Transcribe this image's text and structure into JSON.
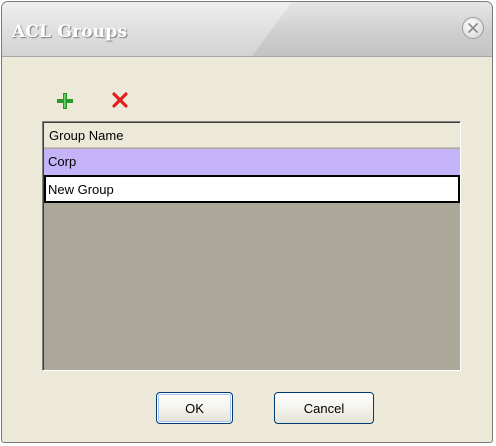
{
  "window": {
    "title": "ACL Groups",
    "close_icon": "close-icon"
  },
  "toolbar": {
    "add_icon": "plus-icon",
    "add_color": "#2a9a2a",
    "delete_icon": "x-icon",
    "delete_color": "#e02020"
  },
  "list": {
    "header": "Group Name",
    "rows": [
      {
        "label": "Corp",
        "selected": true,
        "highlight_color": "#c4b3f8"
      }
    ],
    "edit_row": {
      "value": "New Group"
    }
  },
  "buttons": {
    "ok_label": "OK",
    "cancel_label": "Cancel"
  }
}
